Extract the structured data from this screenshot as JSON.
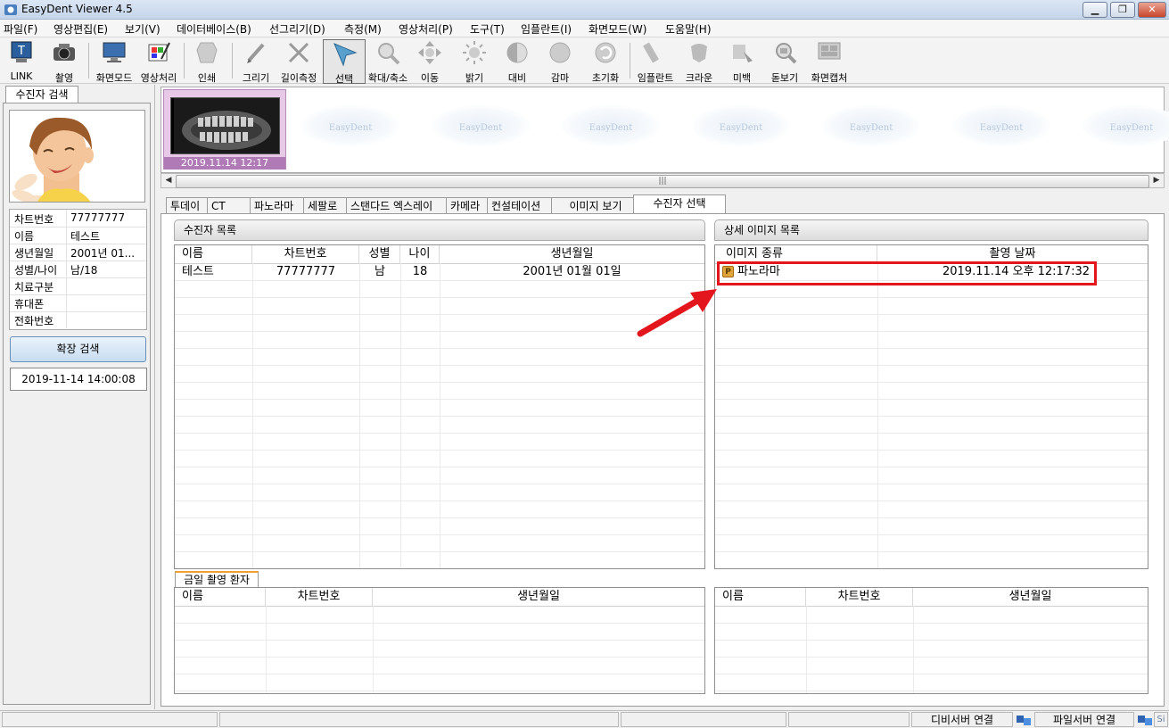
{
  "window": {
    "title": "EasyDent Viewer 4.5"
  },
  "menu": [
    "파일(F)",
    "영상편집(E)",
    "보기(V)",
    "데이터베이스(B)",
    "선그리기(D)",
    "측정(M)",
    "영상처리(P)",
    "도구(T)",
    "임플란트(I)",
    "화면모드(W)",
    "도움말(H)"
  ],
  "toolbar": {
    "link": "LINK",
    "capture": "촬영",
    "screen_mode": "화면모드",
    "image_proc": "영상처리",
    "print": "인쇄",
    "draw": "그리기",
    "measure": "길이측정",
    "select": "선택",
    "zoom": "확대/축소",
    "move": "이동",
    "brightness": "밝기",
    "contrast": "대비",
    "gamma": "감마",
    "reset": "초기화",
    "implant": "임플란트",
    "crown": "크라운",
    "mibaek": "미백",
    "magnifier": "돋보기",
    "screen_capture": "화면캡처"
  },
  "left": {
    "tab": "수진자 검색",
    "info": [
      {
        "k": "차트번호",
        "v": "77777777"
      },
      {
        "k": "이름",
        "v": "테스트"
      },
      {
        "k": "생년월일",
        "v": "2001년 01..."
      },
      {
        "k": "성별/나이",
        "v": "남/18"
      },
      {
        "k": "치료구분",
        "v": ""
      },
      {
        "k": "휴대폰",
        "v": ""
      },
      {
        "k": "전화번호",
        "v": ""
      }
    ],
    "ext_search": "확장 검색",
    "datetime": "2019-11-14 14:00:08"
  },
  "strip": {
    "thumb_label": "2019.11.14 12:17",
    "watermark": "EasyDent"
  },
  "tabs": [
    "투데이",
    "CT",
    "파노라마",
    "세팔로",
    "스탠다드 엑스레이",
    "카메라",
    "컨설테이션",
    "이미지 보기",
    "수진자 선택"
  ],
  "patients": {
    "title": "수진자 목록",
    "headers": [
      "이름",
      "차트번호",
      "성별",
      "나이",
      "생년월일"
    ],
    "rows": [
      [
        "테스트",
        "77777777",
        "남",
        "18",
        "2001년 01월 01일"
      ]
    ]
  },
  "images": {
    "title": "상세 이미지 목록",
    "headers": [
      "이미지 종류",
      "촬영 날짜"
    ],
    "rows": [
      {
        "badge": "P",
        "type": "파노라마",
        "date": "2019.11.14 오후 12:17:32"
      }
    ]
  },
  "today": {
    "tab": "금일 촬영 환자",
    "headers": [
      "이름",
      "차트번호",
      "생년월일"
    ]
  },
  "right_bottom": {
    "headers": [
      "이름",
      "차트번호",
      "생년월일"
    ]
  },
  "status": {
    "db": "디비서버 연결",
    "file": "파일서버 연결",
    "si": "Si"
  },
  "colors": {
    "highlight": "#e3161e",
    "arrow": "#e3161e",
    "thumb_bg": "#e7c8e7"
  }
}
